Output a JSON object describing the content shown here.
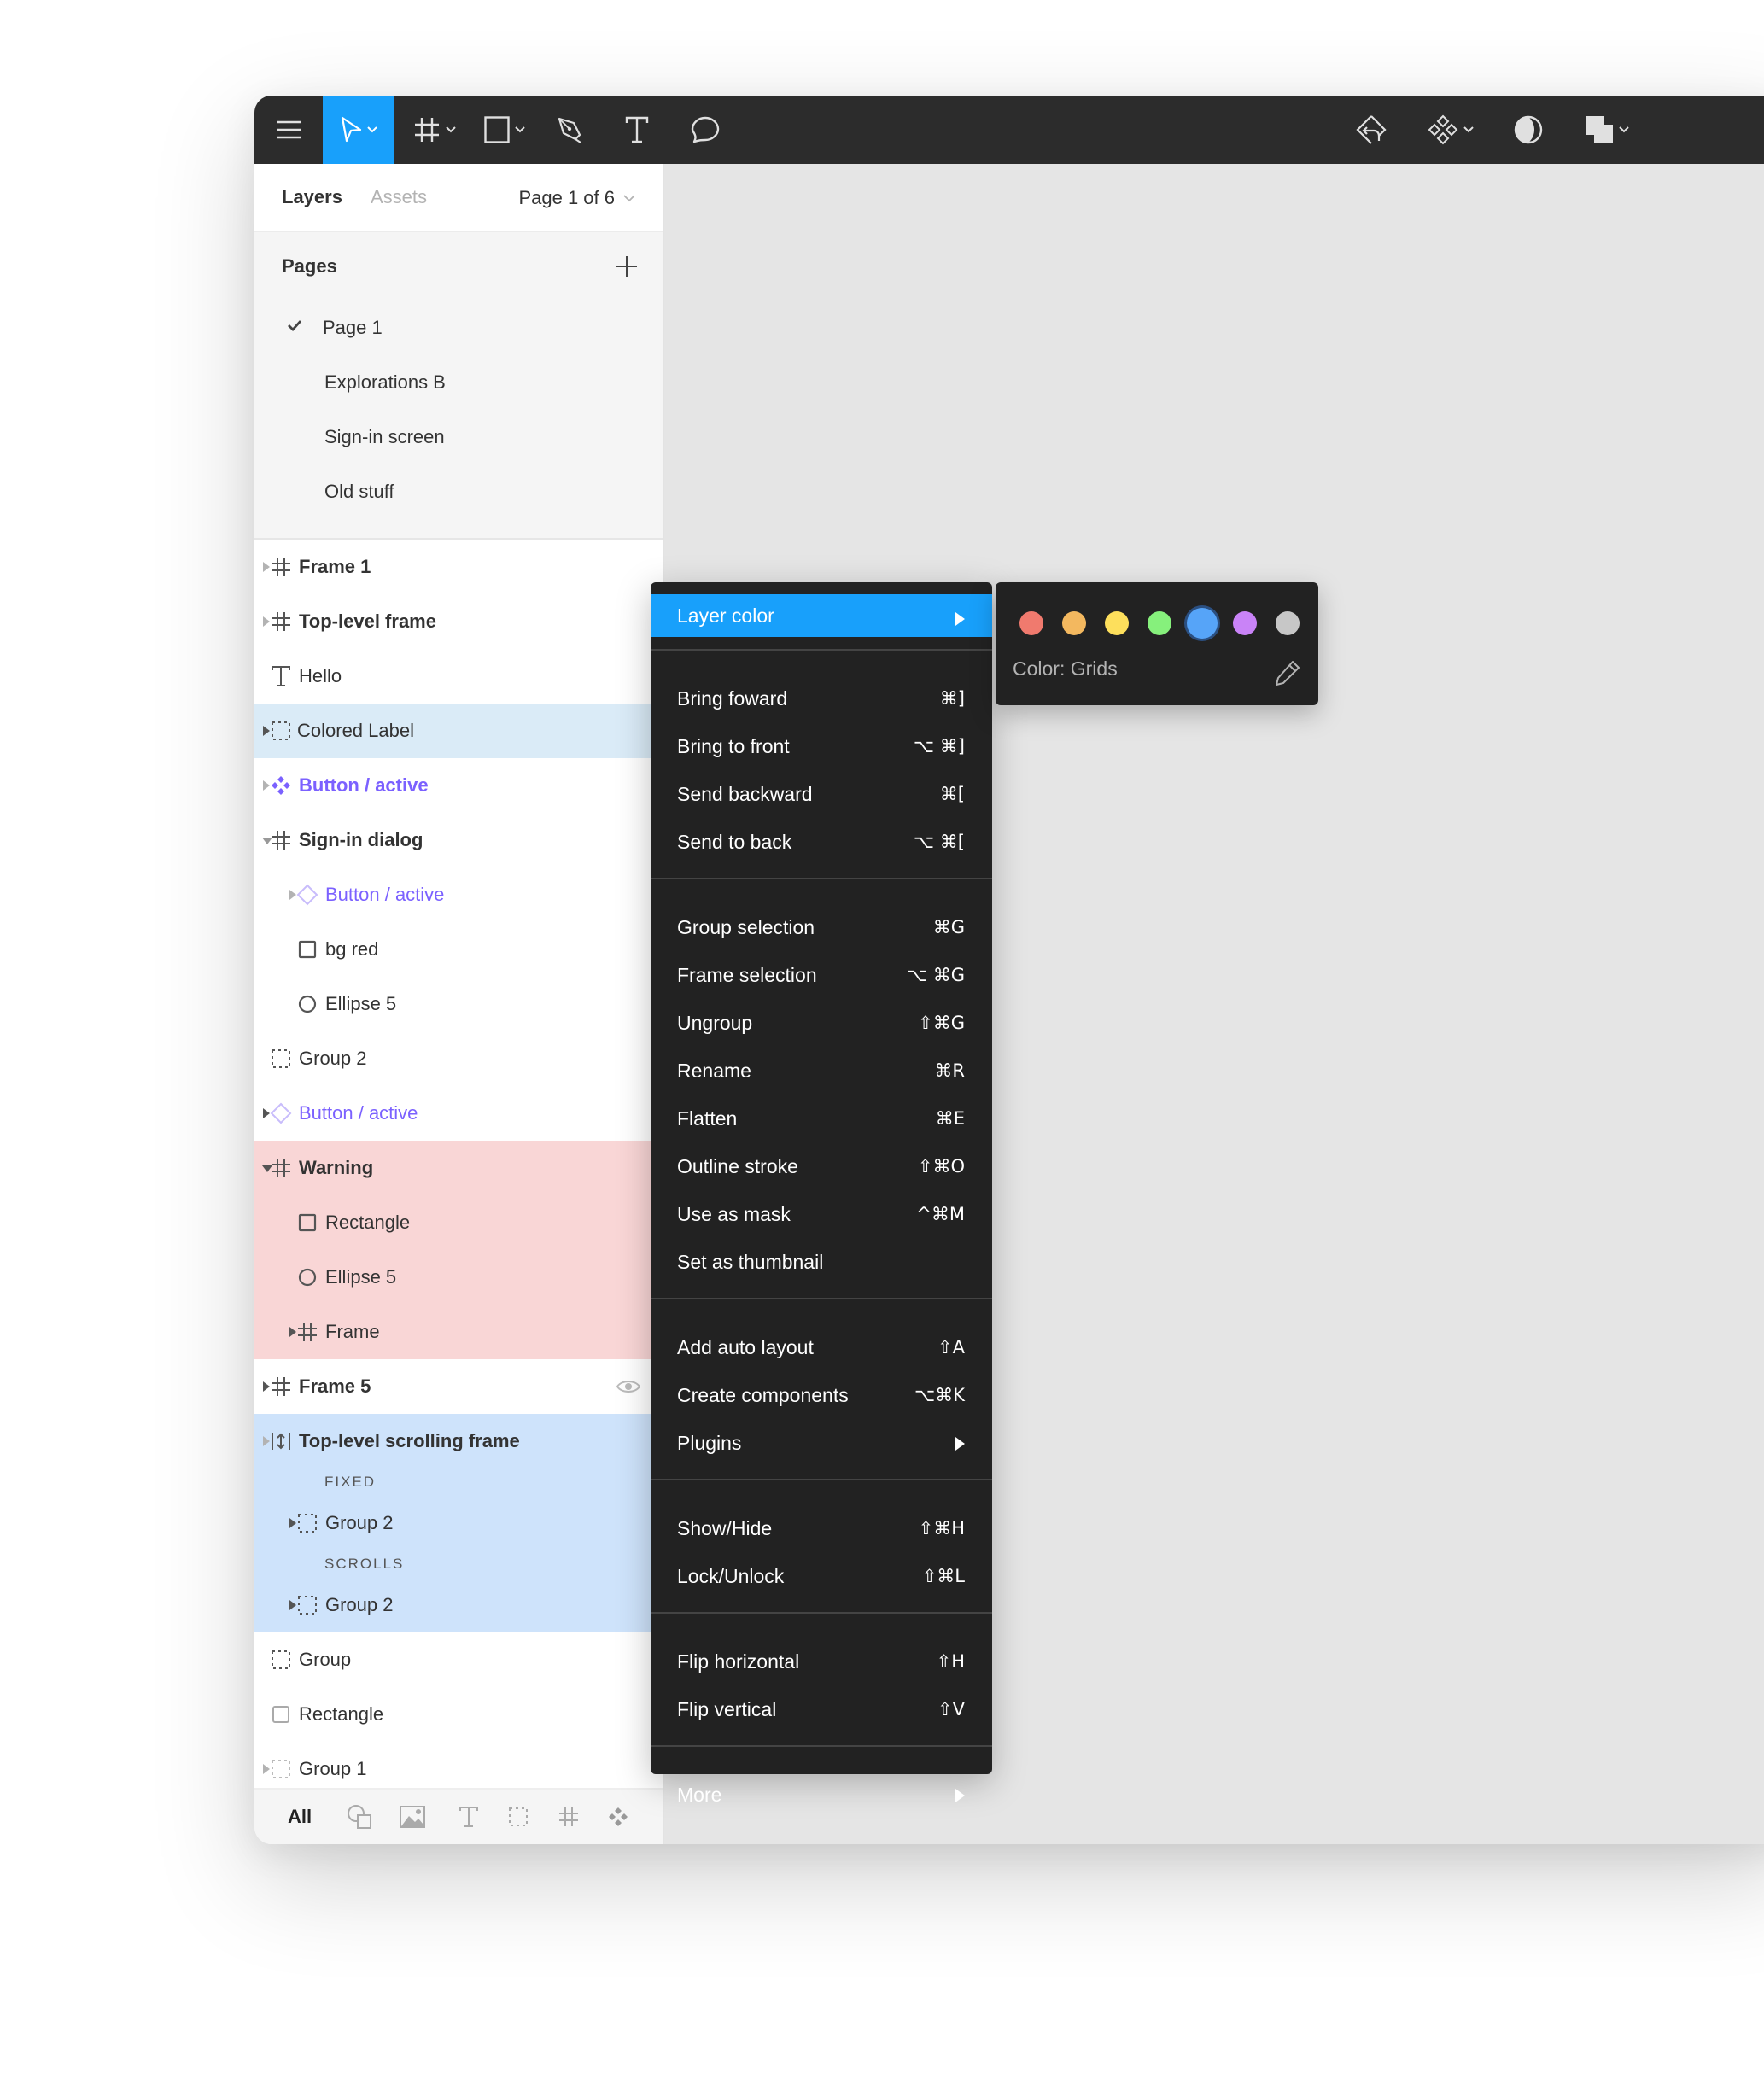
{
  "toolbar": {
    "left_tools": [
      {
        "icon": "hamburger-menu-icon",
        "active": false
      },
      {
        "icon": "move-pointer-icon",
        "active": true,
        "dropdown": true
      },
      {
        "icon": "frame-grid-icon",
        "active": false,
        "dropdown": true
      },
      {
        "icon": "rectangle-icon",
        "active": false,
        "dropdown": true
      },
      {
        "icon": "pen-icon",
        "active": false
      },
      {
        "icon": "text-icon",
        "active": false
      },
      {
        "icon": "comment-icon",
        "active": false
      }
    ],
    "right_tools": [
      {
        "icon": "detach-instance-icon"
      },
      {
        "icon": "components-icon",
        "dropdown": true
      },
      {
        "icon": "contrast-mask-icon"
      },
      {
        "icon": "boolean-union-icon",
        "dropdown": true
      }
    ]
  },
  "sidebar": {
    "tabs": [
      {
        "label": "Layers",
        "active": true
      },
      {
        "label": "Assets",
        "active": false
      }
    ],
    "page_selector": "Page 1 of 6",
    "pages_header": "Pages",
    "pages": [
      {
        "label": "Page 1",
        "current": true
      },
      {
        "label": "Explorations B",
        "current": false
      },
      {
        "label": "Sign-in screen",
        "current": false
      },
      {
        "label": "Old stuff",
        "current": false
      }
    ],
    "layers": [
      {
        "name": "Frame 1",
        "type": "frame",
        "indent": 0,
        "caret": "right",
        "bold": true
      },
      {
        "name": "Top-level frame",
        "type": "frame",
        "indent": 0,
        "caret": "right",
        "bold": true
      },
      {
        "name": "Hello",
        "type": "text",
        "indent": 0,
        "caret": "none"
      },
      {
        "name": "Colored Label",
        "type": "group",
        "indent": 0,
        "caret": "right-dark",
        "highlight": "light-blue"
      },
      {
        "name": "Button / active",
        "type": "component",
        "indent": 0,
        "caret": "right",
        "bold": true,
        "purple": true
      },
      {
        "name": "Sign-in dialog",
        "type": "frame",
        "indent": 0,
        "caret": "down",
        "bold": true
      },
      {
        "name": "Button / active",
        "type": "instance",
        "indent": 1,
        "caret": "right",
        "purple": true
      },
      {
        "name": "bg red",
        "type": "rectangle",
        "indent": 1,
        "caret": "none"
      },
      {
        "name": "Ellipse 5",
        "type": "ellipse",
        "indent": 1,
        "caret": "none"
      },
      {
        "name": "Group 2",
        "type": "group",
        "indent": 0,
        "caret": "none"
      },
      {
        "name": "Button / active",
        "type": "instance",
        "indent": 0,
        "caret": "right-dark",
        "purple": true
      },
      {
        "name": "Warning",
        "type": "frame",
        "indent": 0,
        "caret": "down-dark",
        "bold": true,
        "highlight": "red"
      },
      {
        "name": "Rectangle",
        "type": "rectangle",
        "indent": 1,
        "caret": "none",
        "highlight": "red"
      },
      {
        "name": "Ellipse 5",
        "type": "ellipse",
        "indent": 1,
        "caret": "none",
        "highlight": "red"
      },
      {
        "name": "Frame",
        "type": "frame",
        "indent": 1,
        "caret": "right-dark",
        "highlight": "red"
      },
      {
        "name": "Frame 5",
        "type": "frame",
        "indent": 0,
        "caret": "right-dark",
        "bold": true,
        "eye": true
      },
      {
        "name": "Top-level scrolling frame",
        "type": "scroll-frame",
        "indent": 0,
        "caret": "right",
        "bold": true,
        "highlight": "blue"
      },
      {
        "section": "FIXED"
      },
      {
        "name": "Group 2",
        "type": "group",
        "indent": 1,
        "caret": "right-dark",
        "highlight": "blue"
      },
      {
        "section": "SCROLLS"
      },
      {
        "name": "Group 2",
        "type": "group",
        "indent": 1,
        "caret": "right-dark",
        "highlight": "blue"
      },
      {
        "name": "Group",
        "type": "group",
        "indent": 0,
        "caret": "none"
      },
      {
        "name": "Rectangle",
        "type": "rectangle-light",
        "indent": 0,
        "caret": "none"
      },
      {
        "name": "Group 1",
        "type": "group-light",
        "indent": 0,
        "caret": "right"
      }
    ],
    "filter_bar": {
      "all_label": "All",
      "filters": [
        "shapes-icon",
        "image-icon",
        "text-icon",
        "group-icon",
        "frame-icon",
        "component-icon"
      ]
    }
  },
  "context_menu": {
    "groups": [
      [
        {
          "label": "Layer color",
          "shortcut": "",
          "submenu": true,
          "highlighted": true
        }
      ],
      [
        {
          "label": "Bring foward",
          "shortcut": "⌘]"
        },
        {
          "label": "Bring to front",
          "shortcut": "⌥ ⌘]"
        },
        {
          "label": "Send backward",
          "shortcut": "⌘["
        },
        {
          "label": "Send to back",
          "shortcut": "⌥ ⌘["
        }
      ],
      [
        {
          "label": "Group selection",
          "shortcut": "⌘G"
        },
        {
          "label": "Frame selection",
          "shortcut": "⌥ ⌘G"
        },
        {
          "label": "Ungroup",
          "shortcut": "⇧⌘G"
        },
        {
          "label": "Rename",
          "shortcut": "⌘R"
        },
        {
          "label": "Flatten",
          "shortcut": "⌘E"
        },
        {
          "label": "Outline stroke",
          "shortcut": "⇧⌘O"
        },
        {
          "label": "Use as mask",
          "shortcut": "^⌘M"
        },
        {
          "label": "Set as thumbnail",
          "shortcut": ""
        }
      ],
      [
        {
          "label": "Add auto layout",
          "shortcut": "⇧A"
        },
        {
          "label": "Create components",
          "shortcut": "⌥⌘K"
        },
        {
          "label": "Plugins",
          "shortcut": "",
          "submenu": true
        }
      ],
      [
        {
          "label": "Show/Hide",
          "shortcut": "⇧⌘H"
        },
        {
          "label": "Lock/Unlock",
          "shortcut": "⇧⌘L"
        }
      ],
      [
        {
          "label": "Flip horizontal",
          "shortcut": "⇧H"
        },
        {
          "label": "Flip vertical",
          "shortcut": "⇧V"
        }
      ],
      [
        {
          "label": "More",
          "shortcut": "",
          "submenu": true
        }
      ]
    ]
  },
  "layer_color_submenu": {
    "swatches": [
      {
        "name": "red",
        "color": "#f07a6e",
        "selected": false
      },
      {
        "name": "orange",
        "color": "#f3b85f",
        "selected": false
      },
      {
        "name": "yellow",
        "color": "#fddf5c",
        "selected": false
      },
      {
        "name": "green",
        "color": "#86f07c",
        "selected": false
      },
      {
        "name": "blue",
        "color": "#56a4f8",
        "selected": true
      },
      {
        "name": "violet",
        "color": "#c983f7",
        "selected": false
      },
      {
        "name": "gray",
        "color": "#c7c7c7",
        "selected": false
      }
    ],
    "color_label": "Color: Grids",
    "edit_icon": "pencil-icon"
  },
  "colors": {
    "accent": "#18a0fb",
    "toolbar_bg": "#2c2c2c",
    "menu_bg": "#222222",
    "component_purple": "#7b61ff",
    "highlight_red": "#f9d6d6",
    "highlight_blue": "#cee3fb",
    "canvas": "#e5e5e5"
  }
}
